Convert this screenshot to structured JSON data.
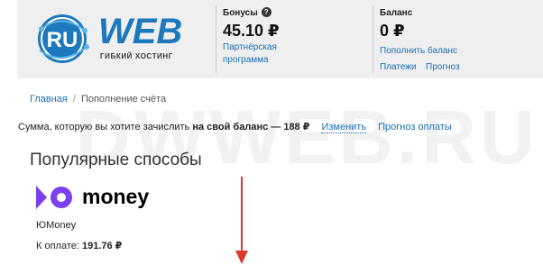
{
  "logo": {
    "badge": "RU",
    "text": "WEB",
    "subtitle": "ГИБКИЙ ХОСТИНГ"
  },
  "bonus": {
    "title": "Бонусы",
    "value": "45.10 ₽",
    "link_line1": "Партнёрская",
    "link_line2": "программа",
    "help": "?"
  },
  "balance": {
    "title": "Баланс",
    "value": "0 ₽",
    "link_topup": "Пополнить баланс",
    "link_payments": "Платежи",
    "link_forecast": "Прогноз"
  },
  "breadcrumb": {
    "home": "Главная",
    "separator": "/",
    "current": "Пополнение счёта"
  },
  "sum": {
    "prefix": "Сумма, которую вы хотите зачислить",
    "bold": "на свой баланс — 188 ₽",
    "change": "Изменить",
    "forecast": "Прогноз оплаты"
  },
  "section": {
    "title": "Популярные способы"
  },
  "method": {
    "logo_word": "money",
    "name": "ЮMoney",
    "pay_label": "К оплате:",
    "pay_amount": "191.76 ₽"
  },
  "watermark": "DWWEB.RU",
  "colors": {
    "link": "#1a6fb5",
    "logo_blue": "#1c79bd",
    "money_purple": "#7b3ef0",
    "arrow": "#d93a2f"
  }
}
